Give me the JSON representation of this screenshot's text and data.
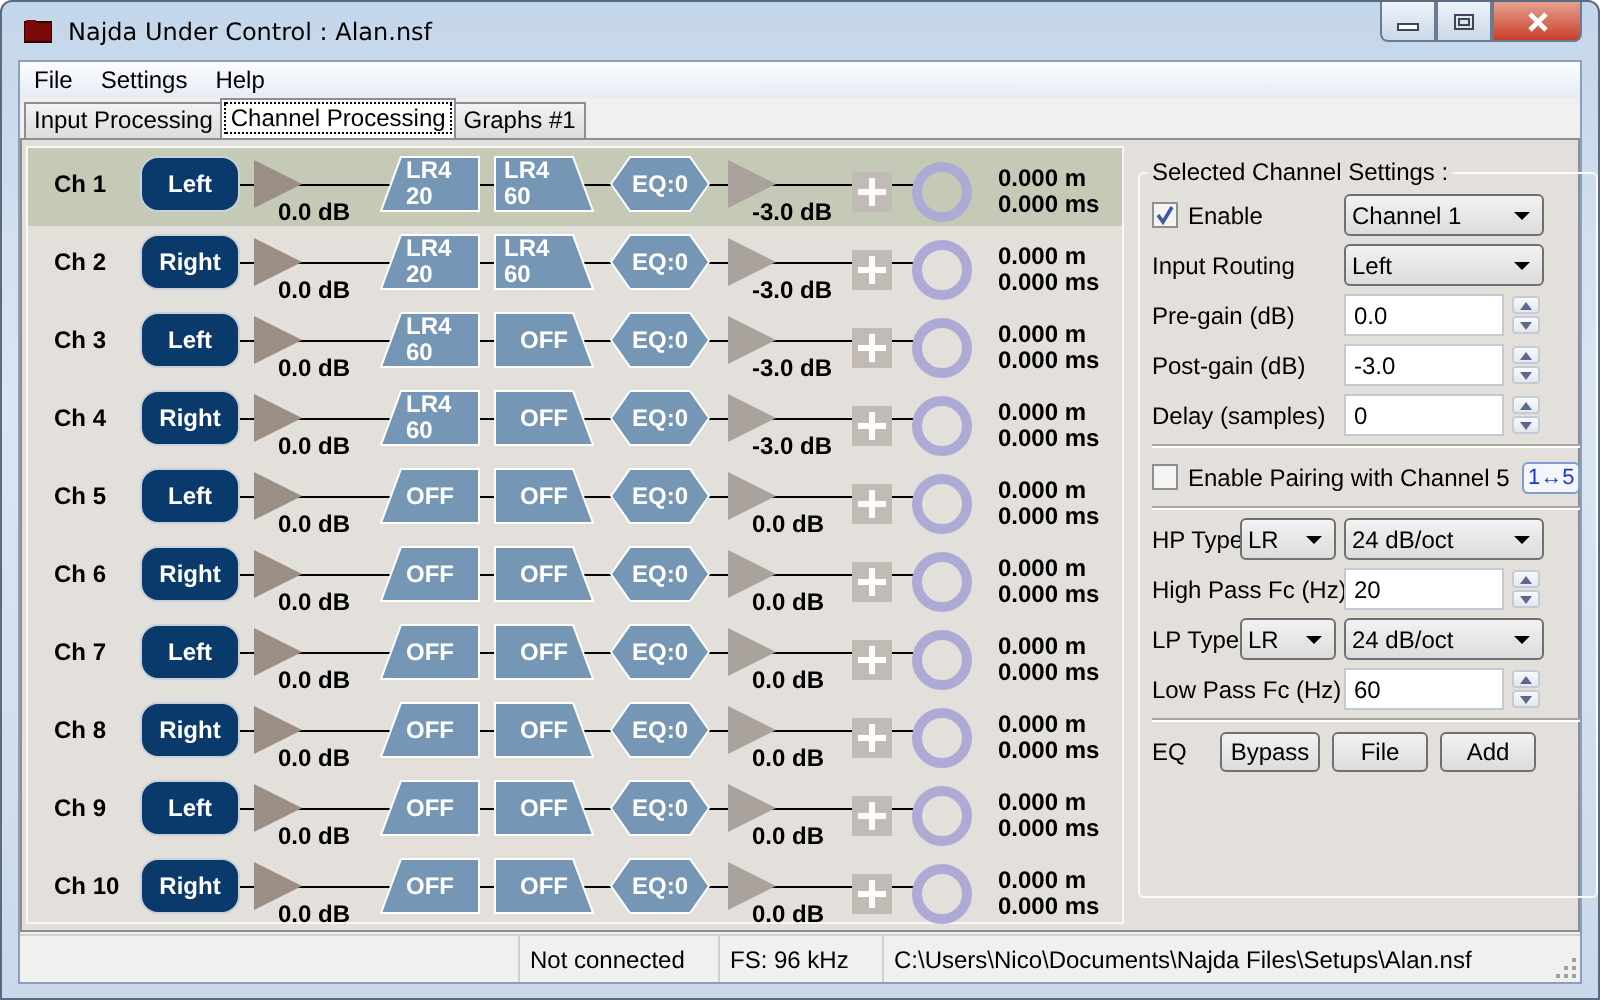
{
  "window": {
    "title": "Najda Under Control : Alan.nsf"
  },
  "menu": [
    {
      "label": "File"
    },
    {
      "label": "Settings"
    },
    {
      "label": "Help"
    }
  ],
  "tabs": [
    {
      "label": "Input Processing",
      "selected": false
    },
    {
      "label": "Channel Processing",
      "selected": true
    },
    {
      "label": "Graphs #1",
      "selected": false
    }
  ],
  "channels": [
    {
      "name": "Ch 1",
      "routing": "Left",
      "selected": true,
      "pre_gain": "0.0 dB",
      "hp": [
        "LR4",
        "20"
      ],
      "lp": [
        "LR4",
        "60"
      ],
      "eq": "EQ:0",
      "post_gain": "-3.0 dB",
      "distance": "0.000 m",
      "delay": "0.000 ms"
    },
    {
      "name": "Ch 2",
      "routing": "Right",
      "selected": false,
      "pre_gain": "0.0 dB",
      "hp": [
        "LR4",
        "20"
      ],
      "lp": [
        "LR4",
        "60"
      ],
      "eq": "EQ:0",
      "post_gain": "-3.0 dB",
      "distance": "0.000 m",
      "delay": "0.000 ms"
    },
    {
      "name": "Ch 3",
      "routing": "Left",
      "selected": false,
      "pre_gain": "0.0 dB",
      "hp": [
        "LR4",
        "60"
      ],
      "lp": [
        "OFF"
      ],
      "eq": "EQ:0",
      "post_gain": "-3.0 dB",
      "distance": "0.000 m",
      "delay": "0.000 ms"
    },
    {
      "name": "Ch 4",
      "routing": "Right",
      "selected": false,
      "pre_gain": "0.0 dB",
      "hp": [
        "LR4",
        "60"
      ],
      "lp": [
        "OFF"
      ],
      "eq": "EQ:0",
      "post_gain": "-3.0 dB",
      "distance": "0.000 m",
      "delay": "0.000 ms"
    },
    {
      "name": "Ch 5",
      "routing": "Left",
      "selected": false,
      "pre_gain": "0.0 dB",
      "hp": [
        "OFF"
      ],
      "lp": [
        "OFF"
      ],
      "eq": "EQ:0",
      "post_gain": "0.0 dB",
      "distance": "0.000 m",
      "delay": "0.000 ms"
    },
    {
      "name": "Ch 6",
      "routing": "Right",
      "selected": false,
      "pre_gain": "0.0 dB",
      "hp": [
        "OFF"
      ],
      "lp": [
        "OFF"
      ],
      "eq": "EQ:0",
      "post_gain": "0.0 dB",
      "distance": "0.000 m",
      "delay": "0.000 ms"
    },
    {
      "name": "Ch 7",
      "routing": "Left",
      "selected": false,
      "pre_gain": "0.0 dB",
      "hp": [
        "OFF"
      ],
      "lp": [
        "OFF"
      ],
      "eq": "EQ:0",
      "post_gain": "0.0 dB",
      "distance": "0.000 m",
      "delay": "0.000 ms"
    },
    {
      "name": "Ch 8",
      "routing": "Right",
      "selected": false,
      "pre_gain": "0.0 dB",
      "hp": [
        "OFF"
      ],
      "lp": [
        "OFF"
      ],
      "eq": "EQ:0",
      "post_gain": "0.0 dB",
      "distance": "0.000 m",
      "delay": "0.000 ms"
    },
    {
      "name": "Ch 9",
      "routing": "Left",
      "selected": false,
      "pre_gain": "0.0 dB",
      "hp": [
        "OFF"
      ],
      "lp": [
        "OFF"
      ],
      "eq": "EQ:0",
      "post_gain": "0.0 dB",
      "distance": "0.000 m",
      "delay": "0.000 ms"
    },
    {
      "name": "Ch 10",
      "routing": "Right",
      "selected": false,
      "pre_gain": "0.0 dB",
      "hp": [
        "OFF"
      ],
      "lp": [
        "OFF"
      ],
      "eq": "EQ:0",
      "post_gain": "0.0 dB",
      "distance": "0.000 m",
      "delay": "0.000 ms"
    }
  ],
  "settings": {
    "title": "Selected Channel Settings :",
    "sections": [
      [
        {
          "kind": "check-select",
          "label": "Enable",
          "checked": true,
          "value": "Channel 1"
        },
        {
          "kind": "select",
          "label": "Input Routing",
          "value": "Left"
        },
        {
          "kind": "spin",
          "label": "Pre-gain (dB)",
          "value": "0.0"
        },
        {
          "kind": "spin",
          "label": "Post-gain (dB)",
          "value": "-3.0"
        },
        {
          "kind": "spin",
          "label": "Delay (samples)",
          "value": "0"
        }
      ],
      [
        {
          "kind": "check-button",
          "label": "Enable Pairing with Channel 5",
          "checked": false,
          "button": "1↔5"
        }
      ],
      [
        {
          "kind": "type",
          "label": "HP Type",
          "type": "LR",
          "slope": "24 dB/oct"
        },
        {
          "kind": "spin",
          "label": "High Pass Fc (Hz)",
          "value": "20"
        },
        {
          "kind": "type",
          "label": "LP Type",
          "type": "LR",
          "slope": "24 dB/oct"
        },
        {
          "kind": "spin",
          "label": "Low Pass Fc (Hz)",
          "value": "60"
        }
      ],
      [
        {
          "kind": "buttons",
          "label": "EQ",
          "buttons": [
            "Bypass",
            "File",
            "Add"
          ]
        }
      ]
    ]
  },
  "status_bar": [
    "Not connected",
    "FS: 96 kHz",
    "C:\\Users\\Nico\\Documents\\Najda Files\\Setups\\Alan.nsf"
  ]
}
